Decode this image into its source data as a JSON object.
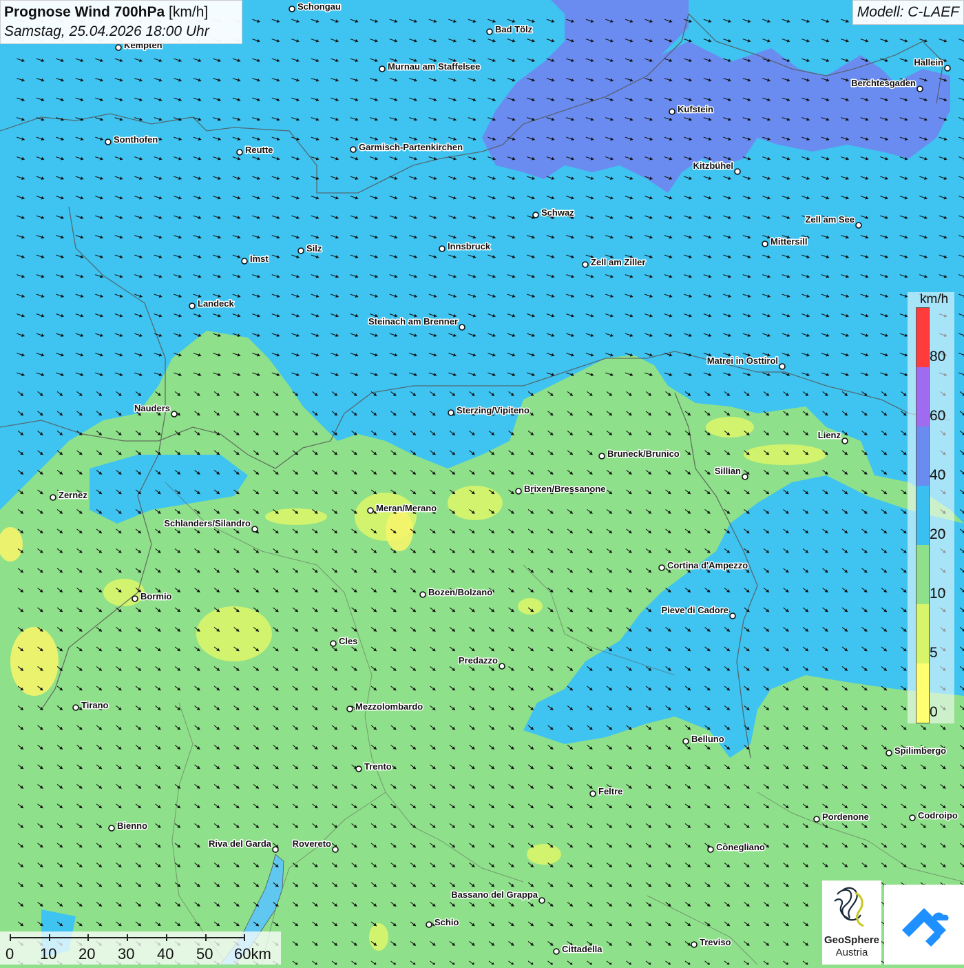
{
  "header": {
    "title_bold": "Prognose Wind 700hPa",
    "title_unit": "[km/h]",
    "subtitle": "Samstag, 25.04.2026 18:00 Uhr",
    "model": "Modell: C-LAEF"
  },
  "legend": {
    "unit": "km/h",
    "colors": [
      "#ff3b3b",
      "#a06bf0",
      "#6a8cf0",
      "#39c0f0",
      "#8fe08a",
      "#d8f56a",
      "#ffff70"
    ],
    "labels": [
      {
        "text": "80",
        "value": 80
      },
      {
        "text": "60",
        "value": 60
      },
      {
        "text": "40",
        "value": 40
      },
      {
        "text": "20",
        "value": 20
      },
      {
        "text": "10",
        "value": 10
      },
      {
        "text": "5",
        "value": 5
      },
      {
        "text": "0",
        "value": 0
      }
    ]
  },
  "scale": {
    "labels": [
      "0",
      "10",
      "20",
      "30",
      "40",
      "50",
      "60km"
    ]
  },
  "logos": {
    "geosphere_line1": "GeoSphere",
    "geosphere_line2": "Austria"
  },
  "cities": [
    {
      "name": "Schongau",
      "lx": "right"
    },
    {
      "name": "Bad Tölz",
      "lx": "right"
    },
    {
      "name": "Kempten",
      "lx": "right"
    },
    {
      "name": "Murnau am Staffelsee",
      "lx": "right"
    },
    {
      "name": "Hallein",
      "lx": "left"
    },
    {
      "name": "Berchtesgaden",
      "lx": "left"
    },
    {
      "name": "Kufstein",
      "lx": "right"
    },
    {
      "name": "Sonthofen",
      "lx": "right"
    },
    {
      "name": "Reutte",
      "lx": "right"
    },
    {
      "name": "Garmisch-Partenkirchen",
      "lx": "right"
    },
    {
      "name": "Kitzbühel",
      "lx": "left"
    },
    {
      "name": "Schwaz",
      "lx": "right"
    },
    {
      "name": "Zell am See",
      "lx": "left"
    },
    {
      "name": "Mittersill",
      "lx": "right"
    },
    {
      "name": "Innsbruck",
      "lx": "right"
    },
    {
      "name": "Silz",
      "lx": "right"
    },
    {
      "name": "Imst",
      "lx": "right"
    },
    {
      "name": "Zell am Ziller",
      "lx": "right"
    },
    {
      "name": "Landeck",
      "lx": "right"
    },
    {
      "name": "Steinach am Brenner",
      "lx": "left"
    },
    {
      "name": "Matrei in Osttirol",
      "lx": "left"
    },
    {
      "name": "Nauders",
      "lx": "left"
    },
    {
      "name": "Sterzing/Vipiteno",
      "lx": "right"
    },
    {
      "name": "Lienz",
      "lx": "left"
    },
    {
      "name": "Bruneck/Brunico",
      "lx": "right"
    },
    {
      "name": "Sillian",
      "lx": "left"
    },
    {
      "name": "Zernez",
      "lx": "right"
    },
    {
      "name": "Brixen/Bressanone",
      "lx": "right"
    },
    {
      "name": "Meran/Merano",
      "lx": "right"
    },
    {
      "name": "Schlanders/Silandro",
      "lx": "left"
    },
    {
      "name": "Cortina d'Ampezzo",
      "lx": "right"
    },
    {
      "name": "Bozen/Bolzano",
      "lx": "right"
    },
    {
      "name": "Bormio",
      "lx": "right"
    },
    {
      "name": "Pieve di Cadore",
      "lx": "left"
    },
    {
      "name": "Cles",
      "lx": "right"
    },
    {
      "name": "Predazzo",
      "lx": "left"
    },
    {
      "name": "Tirano",
      "lx": "right"
    },
    {
      "name": "Mezzolombardo",
      "lx": "right"
    },
    {
      "name": "Belluno",
      "lx": "right"
    },
    {
      "name": "Spilimbergo",
      "lx": "right"
    },
    {
      "name": "Trento",
      "lx": "right"
    },
    {
      "name": "Feltre",
      "lx": "right"
    },
    {
      "name": "Pordenone",
      "lx": "right"
    },
    {
      "name": "Codroipo",
      "lx": "right"
    },
    {
      "name": "Bienno",
      "lx": "right"
    },
    {
      "name": "Riva del Garda",
      "lx": "left"
    },
    {
      "name": "Rovereto",
      "lx": "left"
    },
    {
      "name": "Conegliano",
      "lx": "right"
    },
    {
      "name": "Bassano del Grappa",
      "lx": "left"
    },
    {
      "name": "Schio",
      "lx": "right"
    },
    {
      "name": "Treviso",
      "lx": "right"
    },
    {
      "name": "Cittadella",
      "lx": "right"
    }
  ]
}
